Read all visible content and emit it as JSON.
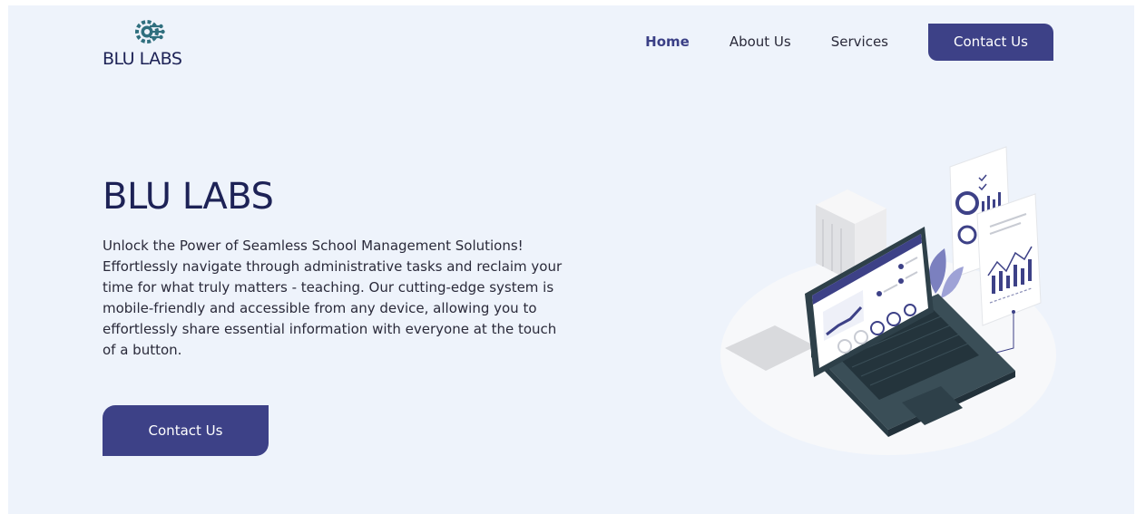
{
  "brand": {
    "name": "BLU LABS",
    "logo_icon": "gear-circuit-icon"
  },
  "nav": {
    "items": [
      {
        "label": "Home",
        "active": true
      },
      {
        "label": "About Us",
        "active": false
      },
      {
        "label": "Services",
        "active": false
      }
    ],
    "cta_label": "Contact Us"
  },
  "hero": {
    "title": "BLU LABS",
    "description": "Unlock the Power of Seamless School Management Solutions! Effortlessly navigate through administrative tasks and reclaim your time for what truly matters - teaching. Our cutting-edge system is mobile-friendly and accessible from any device, allowing you to effortlessly share essential information with everyone at the touch of a button.",
    "cta_label": "Contact Us",
    "illustration": "laptop-dashboard-illustration"
  },
  "colors": {
    "background": "#eef3fb",
    "primary": "#3d4187",
    "heading": "#1d2256",
    "text": "#2a2a3a",
    "teal": "#2f5f6e"
  }
}
